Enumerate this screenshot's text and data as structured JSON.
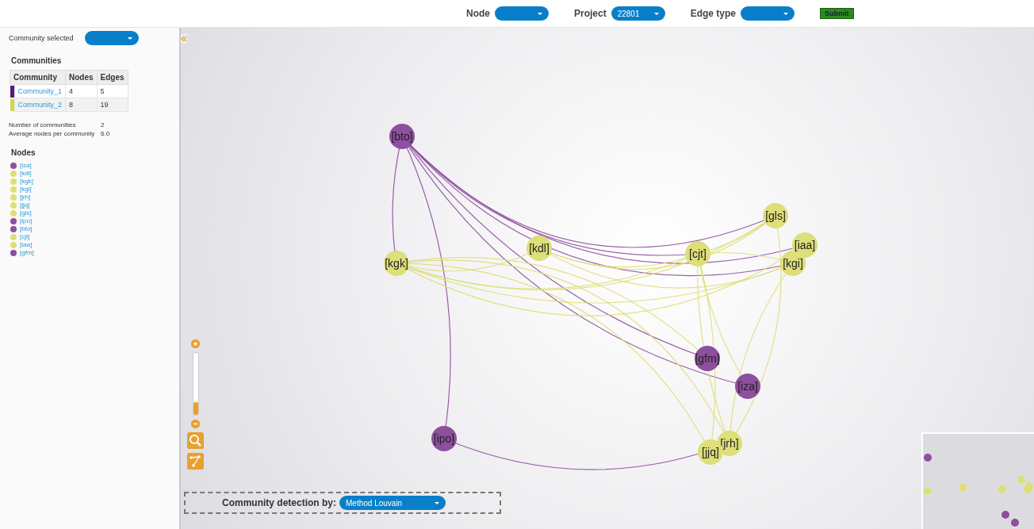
{
  "toolbar": {
    "fields": [
      {
        "label": "Node"
      },
      {
        "label": "Project",
        "value": "22801"
      },
      {
        "label": "Edge type"
      }
    ],
    "submit": "Submit"
  },
  "sidebar": {
    "community_selected": {
      "label": "Community selected"
    },
    "communities_title": "Communities",
    "table": {
      "columns": [
        "Community",
        "Nodes",
        "Edges"
      ],
      "rows": [
        {
          "color": "#5a1a7a",
          "name": "Community_1",
          "nodes": "4",
          "edges": "5"
        },
        {
          "color": "#d4d44a",
          "name": "Community_2",
          "nodes": "8",
          "edges": "19"
        }
      ]
    },
    "stats": [
      {
        "label": "Number of communities",
        "value": "2"
      },
      {
        "label": "Average nodes per community",
        "value": "6.0"
      }
    ],
    "nodes_title": "Nodes",
    "nodes": [
      {
        "label": "[iza]",
        "color": "#8e4f9e"
      },
      {
        "label": "[kdl]",
        "color": "#dede7a"
      },
      {
        "label": "[kgk]",
        "color": "#dede7a"
      },
      {
        "label": "[kgi]",
        "color": "#dede7a"
      },
      {
        "label": "[jrh]",
        "color": "#dede7a"
      },
      {
        "label": "[jjq]",
        "color": "#dede7a"
      },
      {
        "label": "[gls]",
        "color": "#dede7a"
      },
      {
        "label": "[ipo]",
        "color": "#8e4f9e"
      },
      {
        "label": "[bto]",
        "color": "#8e4f9e"
      },
      {
        "label": "[cjt]",
        "color": "#dede7a"
      },
      {
        "label": "[iaa]",
        "color": "#dede7a"
      },
      {
        "label": "[gfm]",
        "color": "#8e4f9e"
      }
    ]
  },
  "graph": {
    "nodes": [
      {
        "label": "[iza]",
        "color": "#8e4f9e"
      },
      {
        "label": "[kdl]",
        "color": "#dede7a"
      },
      {
        "label": "[kgk]",
        "color": "#dede7a"
      },
      {
        "label": "[kgi]",
        "color": "#dede7a"
      },
      {
        "label": "[jrh]",
        "color": "#dede7a"
      },
      {
        "label": "[jjq]",
        "color": "#dede7a"
      },
      {
        "label": "[gls]",
        "color": "#dede7a"
      },
      {
        "label": "[ipo]",
        "color": "#8e4f9e"
      },
      {
        "label": "[bto]",
        "color": "#8e4f9e"
      },
      {
        "label": "[cjt]",
        "color": "#dede7a"
      },
      {
        "label": "[iaa]",
        "color": "#dede7a"
      },
      {
        "label": "[gfm]",
        "color": "#8e4f9e"
      }
    ],
    "zoom_slider": {
      "level": 0.2
    }
  },
  "detection": {
    "label": "Community detection by:",
    "value": "Method Louvain"
  }
}
